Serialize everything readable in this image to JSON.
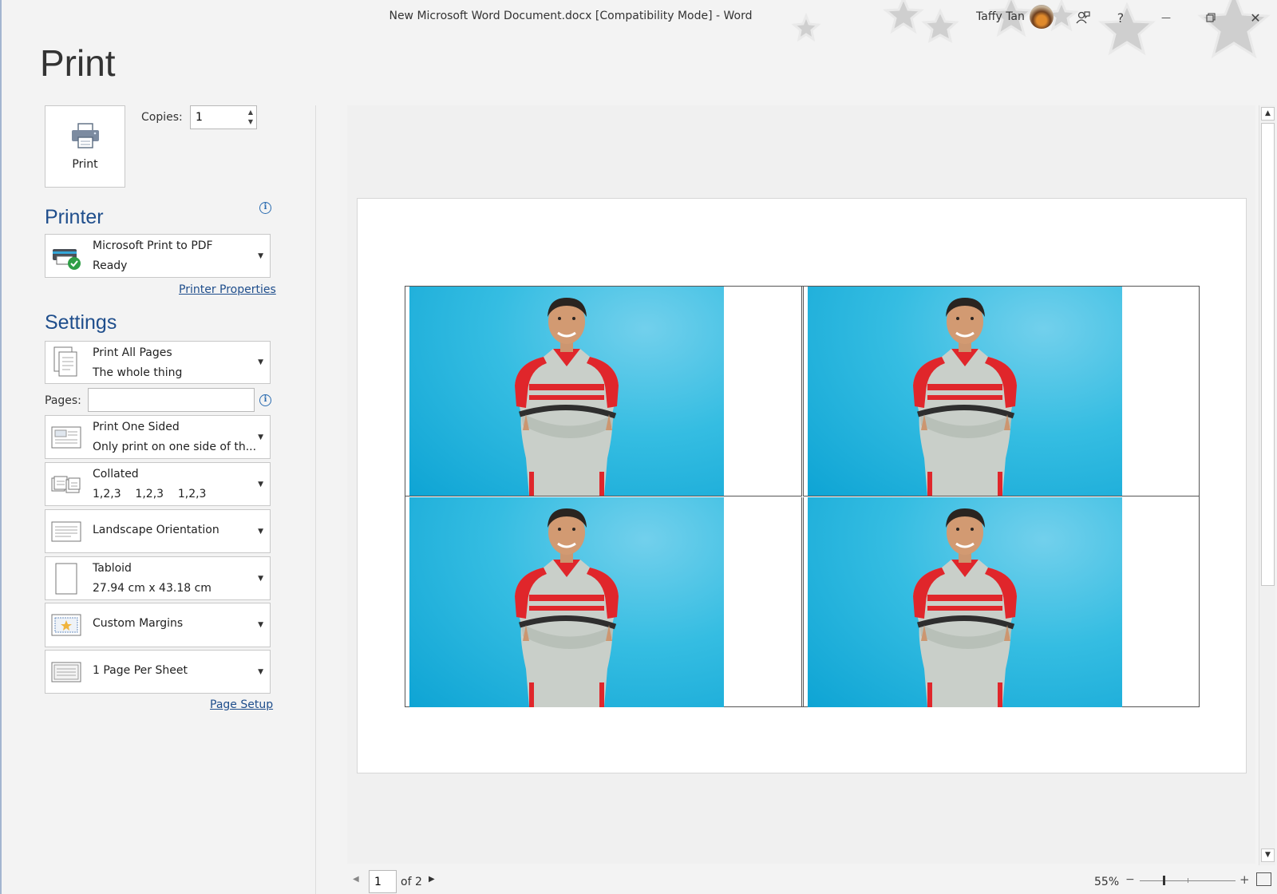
{
  "window": {
    "title": "New Microsoft Word Document.docx [Compatibility Mode]  -  Word",
    "user_name": "Taffy Tan"
  },
  "icons": {
    "coauthor": "coauthor-icon",
    "help": "?",
    "minimize": "—",
    "restore": "restore-icon",
    "close": "✕"
  },
  "print": {
    "title": "Print",
    "button_label": "Print",
    "copies_label": "Copies:",
    "copies_value": "1"
  },
  "printer": {
    "heading": "Printer",
    "name": "Microsoft Print to PDF",
    "status": "Ready",
    "properties_link": "Printer Properties"
  },
  "settings": {
    "heading": "Settings",
    "pages_label": "Pages:",
    "pages_value": "",
    "items": [
      {
        "main": "Print All Pages",
        "sub": "The whole thing"
      },
      {
        "main": "Print One Sided",
        "sub": "Only print on one side of th..."
      },
      {
        "main": "Collated",
        "sub": "1,2,3    1,2,3    1,2,3"
      },
      {
        "main": "Landscape Orientation",
        "sub": ""
      },
      {
        "main": "Tabloid",
        "sub": "27.94 cm x 43.18 cm"
      },
      {
        "main": "Custom Margins",
        "sub": ""
      },
      {
        "main": "1 Page Per Sheet",
        "sub": ""
      }
    ],
    "page_setup_link": "Page Setup"
  },
  "preview": {
    "current_page": "1",
    "of_total": "of 2",
    "zoom": "55%"
  },
  "colors": {
    "accent": "#1f4e8c",
    "photo_background": "#1fb0de"
  }
}
